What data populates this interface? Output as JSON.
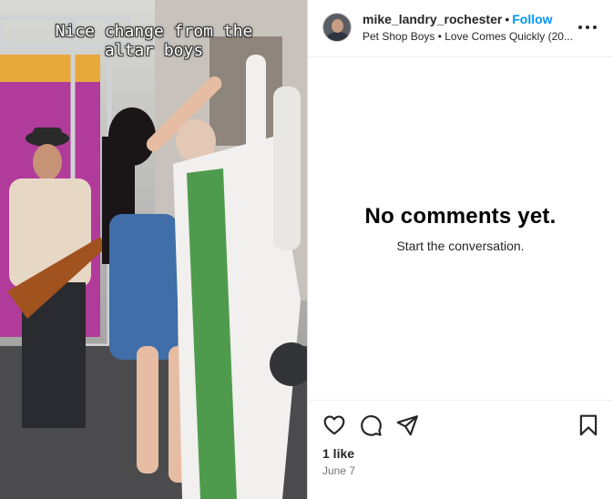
{
  "media": {
    "caption_line1": "Nice change from the",
    "caption_line2": "altar boys"
  },
  "header": {
    "username": "mike_landry_rochester",
    "separator": "•",
    "follow_label": "Follow",
    "audio": "Pet Shop Boys • Love Comes Quickly (20..."
  },
  "comments": {
    "empty_title": "No comments yet.",
    "empty_subtitle": "Start the conversation."
  },
  "footer": {
    "likes": "1 like",
    "date": "June 7",
    "icons": [
      "heart-icon",
      "comment-icon",
      "share-icon",
      "bookmark-icon"
    ]
  }
}
